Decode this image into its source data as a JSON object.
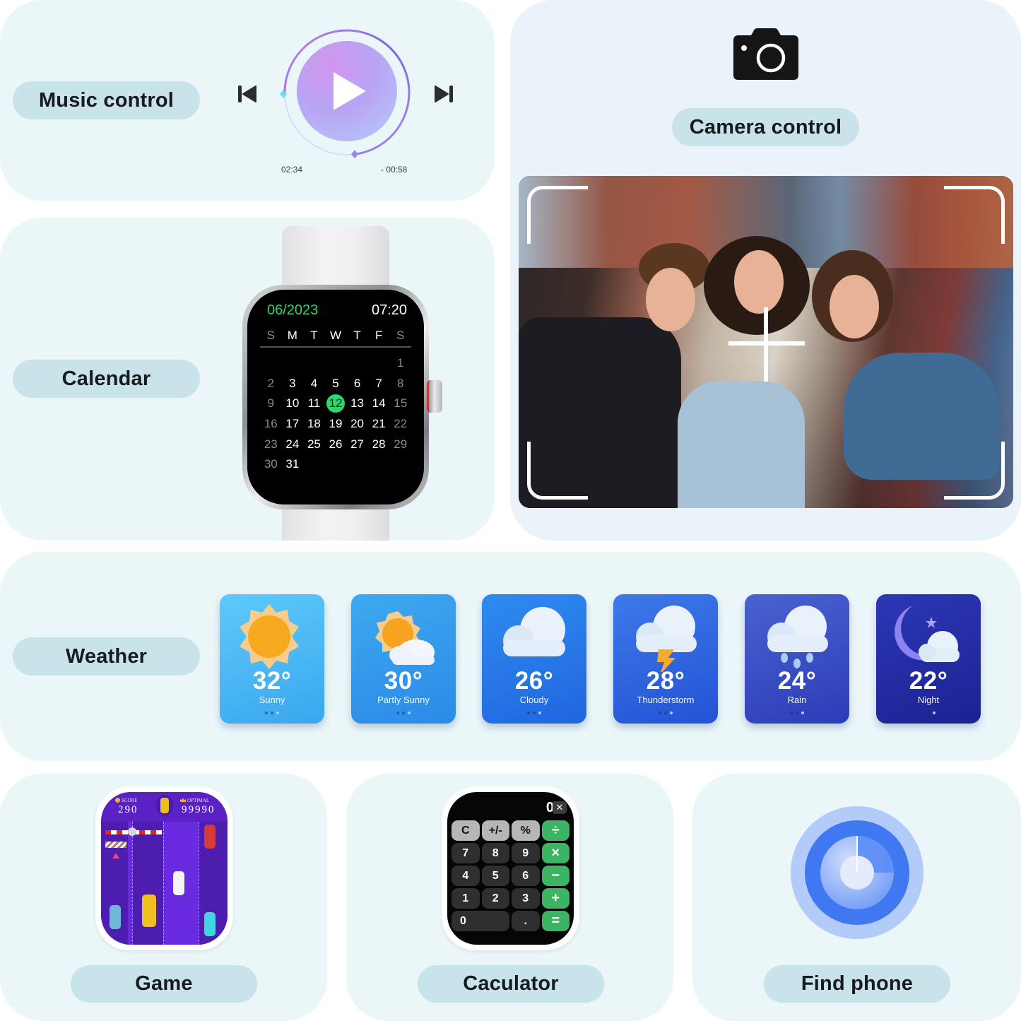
{
  "music": {
    "label": "Music control",
    "elapsed": "02:34",
    "remaining": "- 00:58",
    "progress_fraction": 0.73,
    "icons": {
      "prev": "skip-previous-icon",
      "play": "play-icon",
      "next": "skip-next-icon"
    }
  },
  "calendar": {
    "label": "Calendar",
    "month": "06/2023",
    "time": "07:20",
    "weekdays": [
      "S",
      "M",
      "T",
      "W",
      "T",
      "F",
      "S"
    ],
    "weeks": [
      [
        "",
        "",
        "",
        "",
        "",
        "",
        "1"
      ],
      [
        "2",
        "3",
        "4",
        "5",
        "6",
        "7",
        "8"
      ],
      [
        "9",
        "10",
        "11",
        "12",
        "13",
        "14",
        "15"
      ],
      [
        "16",
        "17",
        "18",
        "19",
        "20",
        "21",
        "22"
      ],
      [
        "23",
        "24",
        "25",
        "26",
        "27",
        "28",
        "29"
      ],
      [
        "30",
        "31",
        "",
        "",
        "",
        "",
        ""
      ]
    ],
    "today": "12",
    "accent": "#2ed573"
  },
  "camera": {
    "label": "Camera control",
    "icon": "camera-icon"
  },
  "weather": {
    "label": "Weather",
    "cards": [
      {
        "temp": "32°",
        "condition": "Sunny",
        "icon": "sun-icon",
        "active_dot": 2,
        "bg_from": "#5ec9fb",
        "bg_to": "#3aa7ee"
      },
      {
        "temp": "30°",
        "condition": "Partly Sunny",
        "icon": "partly-sunny-icon",
        "active_dot": 2,
        "bg_from": "#3da9f1",
        "bg_to": "#2b8ae6"
      },
      {
        "temp": "26°",
        "condition": "Cloudy",
        "icon": "cloud-icon",
        "active_dot": 2,
        "bg_from": "#2f8bef",
        "bg_to": "#2066e0"
      },
      {
        "temp": "28°",
        "condition": "Thunderstorm",
        "icon": "thunderstorm-icon",
        "active_dot": 2,
        "bg_from": "#3c7ae8",
        "bg_to": "#2452d6"
      },
      {
        "temp": "24°",
        "condition": "Rain",
        "icon": "rain-icon",
        "active_dot": 2,
        "bg_from": "#4a62d0",
        "bg_to": "#2c3db8"
      },
      {
        "temp": "22°",
        "condition": "Night",
        "icon": "night-icon",
        "active_dot": 2,
        "bg_from": "#2d37b6",
        "bg_to": "#1b2292"
      }
    ]
  },
  "game": {
    "label": "Game",
    "score_label": "SCORE",
    "score": "290",
    "best_label": "OPTIMAL",
    "best": "99990"
  },
  "calculator": {
    "label": "Caculator",
    "display": "0",
    "backspace": "✕",
    "keys": [
      {
        "label": "C",
        "type": "fn"
      },
      {
        "label": "+/-",
        "type": "fn"
      },
      {
        "label": "%",
        "type": "fn"
      },
      {
        "label": "÷",
        "type": "op"
      },
      {
        "label": "7",
        "type": "num"
      },
      {
        "label": "8",
        "type": "num"
      },
      {
        "label": "9",
        "type": "num"
      },
      {
        "label": "×",
        "type": "op"
      },
      {
        "label": "4",
        "type": "num"
      },
      {
        "label": "5",
        "type": "num"
      },
      {
        "label": "6",
        "type": "num"
      },
      {
        "label": "−",
        "type": "op"
      },
      {
        "label": "1",
        "type": "num"
      },
      {
        "label": "2",
        "type": "num"
      },
      {
        "label": "3",
        "type": "num"
      },
      {
        "label": "+",
        "type": "op"
      },
      {
        "label": "0",
        "type": "zero"
      },
      {
        "label": ".",
        "type": "num"
      },
      {
        "label": "=",
        "type": "op"
      }
    ]
  },
  "find_phone": {
    "label": "Find phone",
    "icon": "radar-icon"
  }
}
